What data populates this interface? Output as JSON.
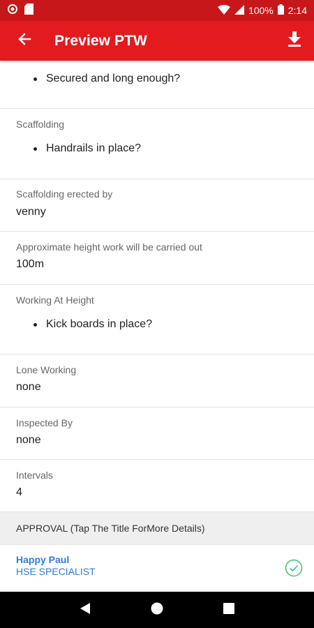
{
  "status_bar": {
    "battery": "100%",
    "time": "2:14"
  },
  "app_bar": {
    "title": "Preview PTW"
  },
  "fields": {
    "top_bullet": "Secured and long enough?",
    "scaffolding": {
      "label": "Scaffolding",
      "bullet": "Handrails in place?"
    },
    "scaffolding_erected_by": {
      "label": "Scaffolding erected by",
      "value": "venny"
    },
    "approx_height": {
      "label": "Approximate height work will be carried out",
      "value": "100m"
    },
    "working_at_height": {
      "label": "Working At Height",
      "bullet": "Kick boards in place?"
    },
    "lone_working": {
      "label": "Lone Working",
      "value": "none"
    },
    "inspected_by": {
      "label": "Inspected By",
      "value": "none"
    },
    "intervals": {
      "label": "Intervals",
      "value": "4"
    }
  },
  "approval": {
    "header": "APPROVAL (Tap The Title ForMore Details)",
    "approver_name": "Happy Paul",
    "approver_role": "HSE SPECIALIST"
  },
  "colors": {
    "app_bar": "#e31b1f",
    "status_bar": "#c8171a",
    "link": "#2e7be3",
    "approved_check": "#3cc36a"
  },
  "icons": [
    "back-arrow-icon",
    "download-icon",
    "check-circle-icon",
    "nav-back-icon",
    "nav-home-icon",
    "nav-recents-icon"
  ]
}
